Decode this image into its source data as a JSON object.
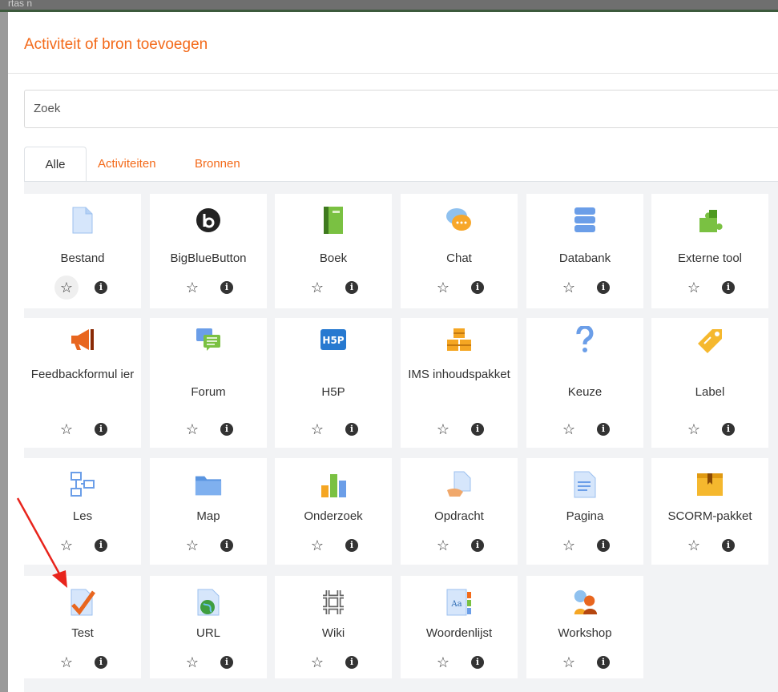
{
  "background": {
    "fragment_text": "rtas n"
  },
  "modal": {
    "title": "Activiteit of bron toevoegen",
    "search": {
      "placeholder": "Zoek"
    },
    "tabs": [
      {
        "label": "Alle",
        "active": true
      },
      {
        "label": "Activiteiten",
        "active": false
      },
      {
        "label": "Bronnen",
        "active": false
      }
    ],
    "items": [
      {
        "label": "Bestand",
        "icon": "file-icon"
      },
      {
        "label": "BigBlueButton",
        "icon": "bigbluebutton-icon"
      },
      {
        "label": "Boek",
        "icon": "book-icon"
      },
      {
        "label": "Chat",
        "icon": "chat-icon"
      },
      {
        "label": "Databank",
        "icon": "database-icon"
      },
      {
        "label": "Externe tool",
        "icon": "puzzle-icon"
      },
      {
        "label": "Feedbackformul ier",
        "icon": "megaphone-icon"
      },
      {
        "label": "Forum",
        "icon": "forum-icon"
      },
      {
        "label": "H5P",
        "icon": "h5p-icon"
      },
      {
        "label": "IMS inhoudspakket",
        "icon": "package-icon"
      },
      {
        "label": "Keuze",
        "icon": "question-icon"
      },
      {
        "label": "Label",
        "icon": "tag-icon"
      },
      {
        "label": "Les",
        "icon": "lesson-icon"
      },
      {
        "label": "Map",
        "icon": "folder-icon"
      },
      {
        "label": "Onderzoek",
        "icon": "survey-icon"
      },
      {
        "label": "Opdracht",
        "icon": "assignment-icon"
      },
      {
        "label": "Pagina",
        "icon": "page-icon"
      },
      {
        "label": "SCORM-pakket",
        "icon": "scorm-icon"
      },
      {
        "label": "Test",
        "icon": "quiz-icon"
      },
      {
        "label": "URL",
        "icon": "url-icon"
      },
      {
        "label": "Wiki",
        "icon": "wiki-icon"
      },
      {
        "label": "Woordenlijst",
        "icon": "glossary-icon"
      },
      {
        "label": "Workshop",
        "icon": "workshop-icon"
      }
    ],
    "star_glyph": "☆",
    "info_glyph": "i"
  },
  "colors": {
    "accent": "#f36a1a",
    "grid_bg": "#f2f3f5",
    "annotation_arrow": "#e8241c"
  }
}
